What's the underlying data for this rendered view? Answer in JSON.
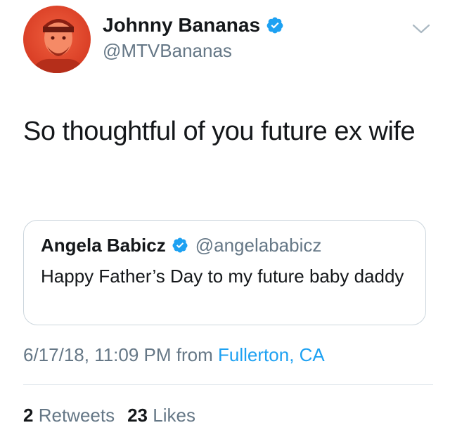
{
  "tweet": {
    "author": {
      "display_name": "Johnny Bananas",
      "handle": "@MTVBananas",
      "verified": true,
      "avatar_icon": "user-avatar"
    },
    "text": "So thoughtful of you future ex wife",
    "menu_icon": "chevron-down-icon",
    "quoted_tweet": {
      "display_name": "Angela Babicz",
      "handle": "@angelababicz",
      "verified": true,
      "text": "Happy Father’s Day to my future baby daddy"
    },
    "timestamp": "6/17/18, 11:09 PM",
    "from_label": "from",
    "location": "Fullerton, CA",
    "stats": {
      "retweets_count": "2",
      "retweets_label": "Retweets",
      "likes_count": "23",
      "likes_label": "Likes"
    }
  },
  "colors": {
    "verified_blue": "#1da1f2",
    "link_blue": "#1da1f2",
    "secondary_text": "#657786",
    "primary_text": "#14171a",
    "border": "#ccd6dd",
    "avatar_red": "#e8432d"
  }
}
